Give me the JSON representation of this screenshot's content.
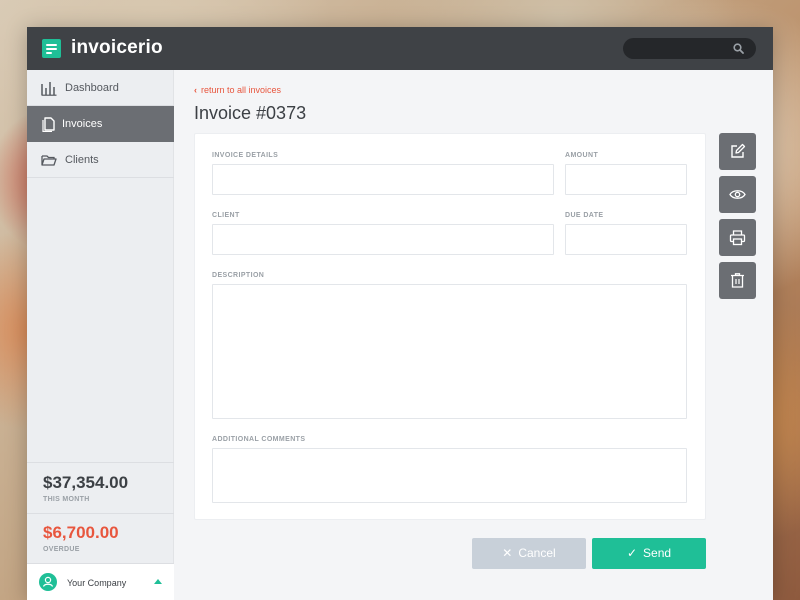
{
  "app": {
    "title": "invoicerio"
  },
  "search": {
    "placeholder": "",
    "value": ""
  },
  "sidebar": {
    "items": [
      {
        "label": "Dashboard",
        "icon": "bar-chart-icon"
      },
      {
        "label": "Invoices",
        "icon": "document-icon",
        "active": true
      },
      {
        "label": "Clients",
        "icon": "folder-icon"
      }
    ],
    "stats": [
      {
        "value": "$37,354.00",
        "label": "THIS MONTH"
      },
      {
        "value": "$6,700.00",
        "label": "OVERDUE"
      }
    ],
    "company": {
      "name": "Your Company"
    }
  },
  "page": {
    "back_link": "return to all invoices",
    "title": "Invoice #0373"
  },
  "form": {
    "invoice_details_label": "INVOICE DETAILS",
    "amount_label": "AMOUNT",
    "client_label": "CLIENT",
    "due_date_label": "DUE DATE",
    "description_label": "DESCRIPTION",
    "additional_comments_label": "ADDITIONAL COMMENTS"
  },
  "actions": {
    "cancel_label": "Cancel",
    "send_label": "Send"
  },
  "colors": {
    "accent": "#1fbf97",
    "alert": "#e8563e",
    "topbar": "#3f4246",
    "sidebar_active": "#6b6e73"
  }
}
